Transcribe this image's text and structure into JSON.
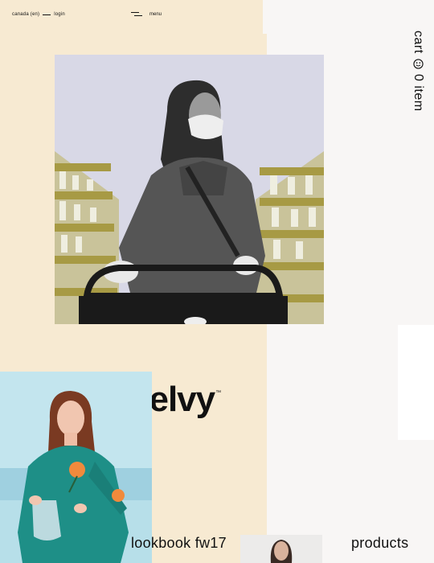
{
  "header": {
    "region": "canada (en)",
    "login": "login",
    "menu_label": "menu",
    "menu_icon": "hamburger-menu-icon"
  },
  "cart": {
    "label": "cart",
    "count_text": "0 item",
    "icon": "smiley-face-icon"
  },
  "brand": {
    "name": "yelvy",
    "trademark": "™"
  },
  "nav": {
    "lookbook": "lookbook fw17",
    "products": "products"
  },
  "colors": {
    "cream": "#f7ead2",
    "background": "#f8f6f5",
    "hero_tint": "#d8d8e6",
    "shelf_olive": "#a79a44",
    "model_bg": "#bfe4ef",
    "sweater_teal": "#1e8f87",
    "flower_orange": "#f08a3c"
  }
}
